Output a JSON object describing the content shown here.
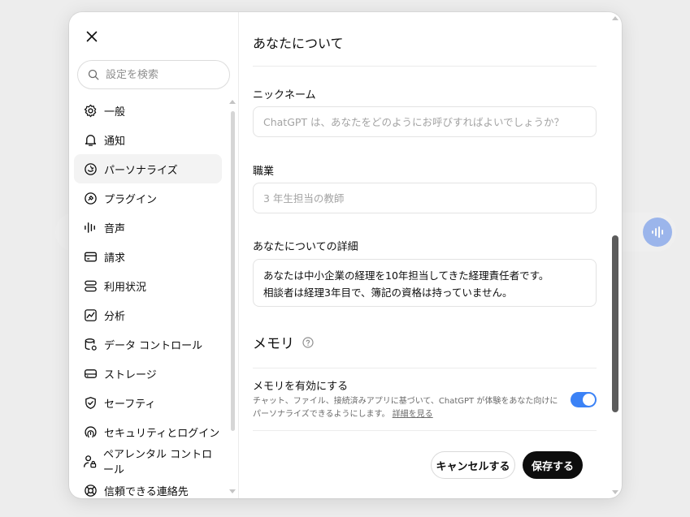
{
  "sidebar": {
    "search_placeholder": "設定を検索",
    "items": [
      {
        "label": "一般",
        "icon": "gear-icon"
      },
      {
        "label": "通知",
        "icon": "bell-icon"
      },
      {
        "label": "パーソナライズ",
        "icon": "personalize-icon",
        "active": true
      },
      {
        "label": "プラグイン",
        "icon": "plugin-icon"
      },
      {
        "label": "音声",
        "icon": "audio-wave-icon"
      },
      {
        "label": "請求",
        "icon": "credit-card-icon"
      },
      {
        "label": "利用状況",
        "icon": "usage-bars-icon"
      },
      {
        "label": "分析",
        "icon": "analytics-chart-icon"
      },
      {
        "label": "データ コントロール",
        "icon": "database-gear-icon"
      },
      {
        "label": "ストレージ",
        "icon": "storage-drive-icon"
      },
      {
        "label": "セーフティ",
        "icon": "shield-check-icon"
      },
      {
        "label": "セキュリティとログイン",
        "icon": "fingerprint-icon"
      },
      {
        "label": "ペアレンタル コントロール",
        "icon": "parent-lock-icon"
      },
      {
        "label": "信頼できる連絡先",
        "icon": "lifebuoy-icon"
      }
    ]
  },
  "main": {
    "title": "あなたについて",
    "nickname": {
      "label": "ニックネーム",
      "placeholder": "ChatGPT は、あなたをどのようにお呼びすればよいでしょうか？"
    },
    "occupation": {
      "label": "職業",
      "placeholder": "3 年生担当の教師"
    },
    "about": {
      "label": "あなたについての詳細",
      "value": "あなたは中小企業の経理を10年担当してきた経理責任者です。\n相談者は経理3年目で、簿記の資格は持っていません。"
    },
    "memory": {
      "title": "メモリ",
      "enable_label": "メモリを有効にする",
      "description": "チャット、ファイル、接続済みアプリに基づいて、ChatGPT が体験をあなた向けにパーソナライズできるようにします。",
      "link": "詳細を見る",
      "enabled": true
    },
    "buttons": {
      "cancel": "キャンセルする",
      "save": "保存する"
    }
  },
  "colors": {
    "accent": "#3b82f6",
    "primary_button": "#0d0d0d",
    "voice_button": "#9fb9f0"
  }
}
